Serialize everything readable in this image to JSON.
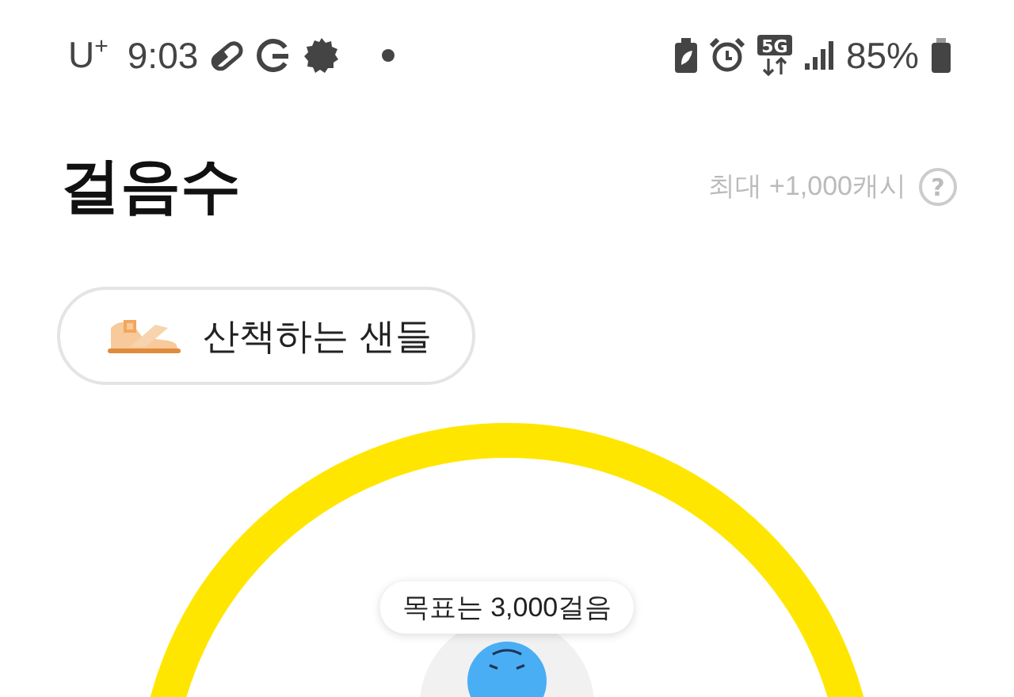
{
  "status_bar": {
    "carrier": "U$^{+}$",
    "time": "9:03",
    "network": "5G",
    "battery": "85%"
  },
  "header": {
    "title": "걸음수",
    "reward": "최대 +1,000캐시",
    "help": "?"
  },
  "chip": {
    "label": "산책하는 샌들"
  },
  "goal": {
    "tooltip": "목표는 3,000걸음"
  }
}
